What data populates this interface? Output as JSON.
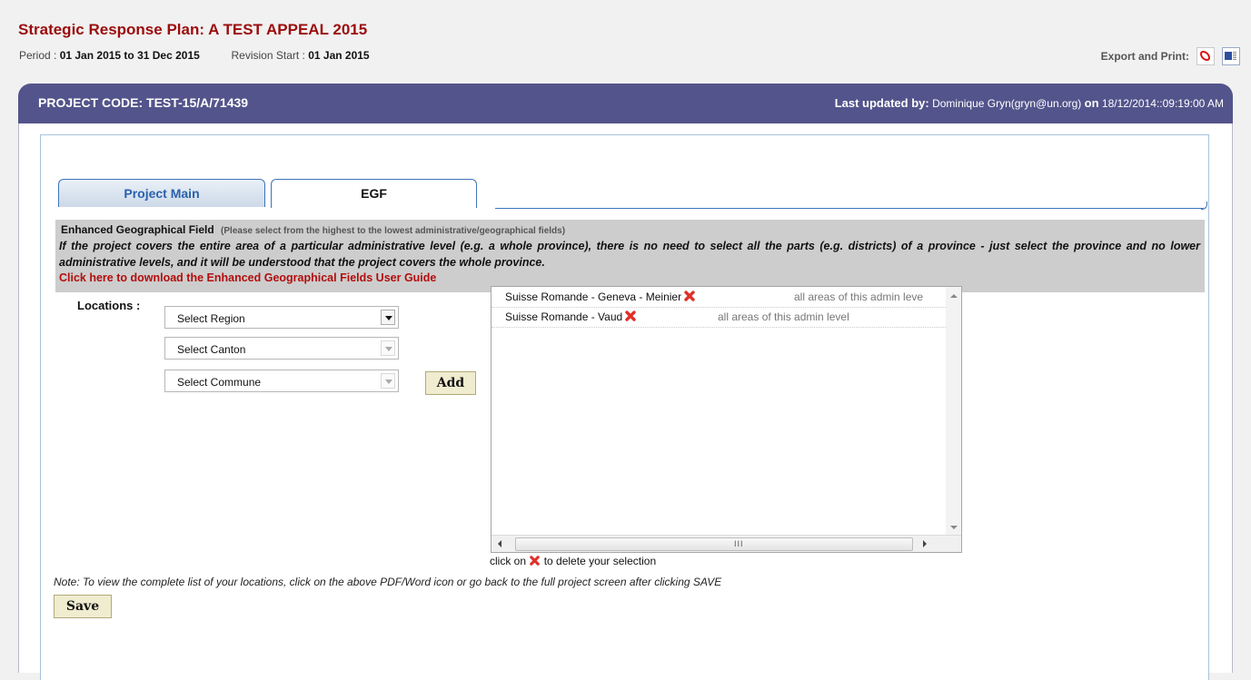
{
  "header": {
    "title": "Strategic Response Plan: A TEST APPEAL 2015",
    "period_label": "Period :",
    "period_value": "01 Jan 2015 to 31 Dec 2015",
    "revision_label": "Revision Start :",
    "revision_value": "01 Jan 2015",
    "export_label": "Export and Print:"
  },
  "project": {
    "code": "PROJECT CODE: TEST-15/A/71439",
    "updated_label": "Last updated by:",
    "updated_by": "Dominique Gryn(gryn@un.org)",
    "on_label": "on",
    "updated_at": "18/12/2014::09:19:00 AM"
  },
  "tabs": [
    {
      "label": "Project Main",
      "active": false
    },
    {
      "label": "EGF",
      "active": true
    }
  ],
  "egf": {
    "heading": "Enhanced Geographical Field",
    "heading_note": "(Please select from the highest to the lowest administrative/geographical fields)",
    "explanation": "If the project covers the entire area of a particular administrative level (e.g. a whole province), there is no need to select all the parts (e.g. districts) of a province - just select the province and no lower administrative levels, and it will be understood that the project covers the whole province.",
    "guide_link": "Click here to download the Enhanced Geographical Fields User Guide"
  },
  "locations": {
    "label": "Locations :",
    "region": "Select Region",
    "canton": "Select Canton",
    "commune": "Select Commune",
    "add_label": "Add",
    "selected": [
      {
        "name": "Suisse Romande - Geneva - Meinier",
        "note": "all areas of this admin leve"
      },
      {
        "name": "Suisse Romande - Vaud",
        "note": "all areas of this admin level"
      }
    ],
    "scroll_grip": "III",
    "delete_hint_pre": "click on",
    "delete_hint_post": "to delete your selection"
  },
  "footer": {
    "note": "Note: To view the complete list of your locations, click on the above PDF/Word icon or go back to the full project screen after clicking SAVE",
    "save_label": "Save"
  },
  "icons": {
    "pdf": "pdf-icon",
    "word": "word-icon",
    "delete": "red-x-icon",
    "delete_color": "#e0302a"
  },
  "colors": {
    "title": "#9b0c0c",
    "header_bar": "#53548b",
    "tab_border": "#3f74b8",
    "info_bg": "#cdcdcd",
    "link": "#b30d0d"
  }
}
